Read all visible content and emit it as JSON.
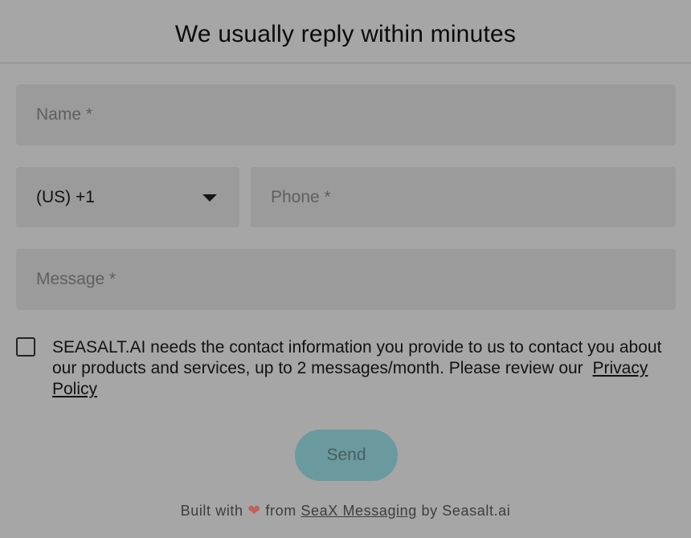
{
  "header": {
    "title": "We usually reply within minutes"
  },
  "form": {
    "name_placeholder": "Name *",
    "country_code_value": "(US) +1",
    "phone_placeholder": "Phone *",
    "message_placeholder": "Message *",
    "consent_text": "SEASALT.AI needs the contact information you provide to us to contact you about our products and services, up to 2 messages/month. Please review our",
    "privacy_link": "Privacy Policy",
    "consent_checked": false,
    "send_label": "Send"
  },
  "footer": {
    "built_with": "Built with",
    "heart_icon": "heart-icon",
    "from": "from",
    "link": "SeaX Messaging",
    "by": "by Seasalt.ai"
  },
  "colors": {
    "send_button": "#6a9a9e",
    "heart": "#c0605f"
  }
}
